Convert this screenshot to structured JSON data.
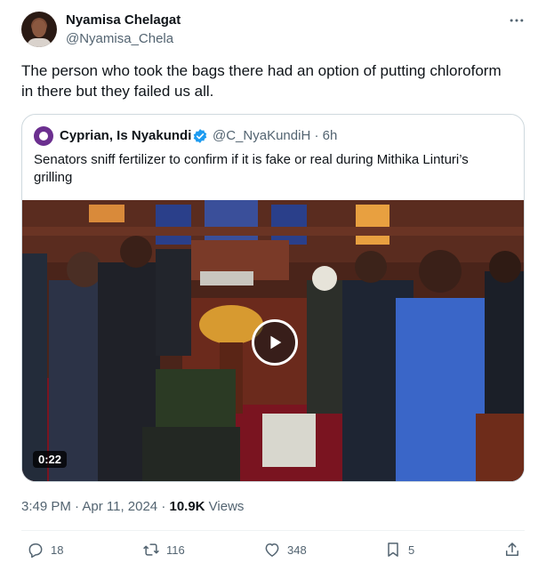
{
  "author": {
    "name": "Nyamisa Chelagat",
    "handle": "@Nyamisa_Chela"
  },
  "post": {
    "text_line1": "The person who took the bags there had an option of putting chloroform",
    "text_line2": "in there but they failed us all."
  },
  "quoted": {
    "name": "Cyprian, Is Nyakundi",
    "handle_time": "@C_NyaKundiH · 6h",
    "text_line1": "Senators sniff fertilizer to confirm if it is fake or real during Mithika Linturi’s",
    "text_line2": "grilling",
    "video_duration": "0:22",
    "verified_color": "#1d9bf0"
  },
  "meta": {
    "timestamp": "3:49 PM · Apr 11, 2024 · ",
    "views_count": "10.9K",
    "views_label": " Views"
  },
  "actions": {
    "replies": "18",
    "reposts": "116",
    "likes": "348",
    "bookmarks": "5"
  },
  "icons": [
    "more-icon",
    "verified-badge-icon",
    "play-icon",
    "reply-icon",
    "repost-icon",
    "like-icon",
    "bookmark-icon",
    "share-icon"
  ]
}
